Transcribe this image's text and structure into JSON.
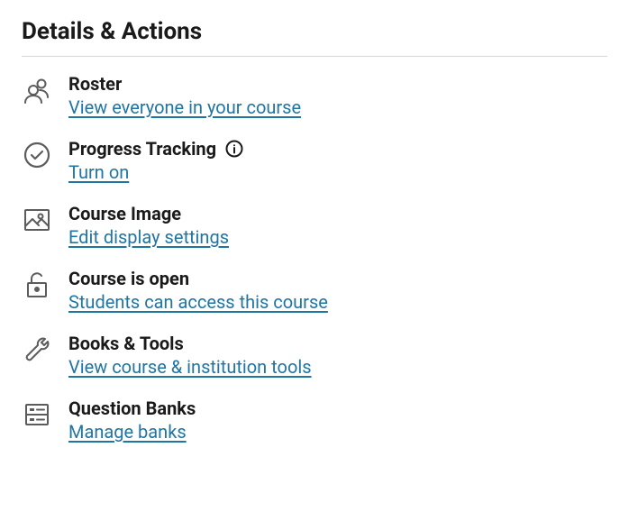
{
  "heading": "Details & Actions",
  "items": [
    {
      "title": "Roster",
      "link": "View everyone in your course",
      "info": false
    },
    {
      "title": "Progress Tracking",
      "link": "Turn on",
      "info": true
    },
    {
      "title": "Course Image",
      "link": "Edit display settings",
      "info": false
    },
    {
      "title": "Course is open",
      "link": "Students can access this course",
      "info": false
    },
    {
      "title": "Books & Tools",
      "link": "View course & institution tools",
      "info": false
    },
    {
      "title": "Question Banks",
      "link": "Manage banks",
      "info": false
    }
  ]
}
